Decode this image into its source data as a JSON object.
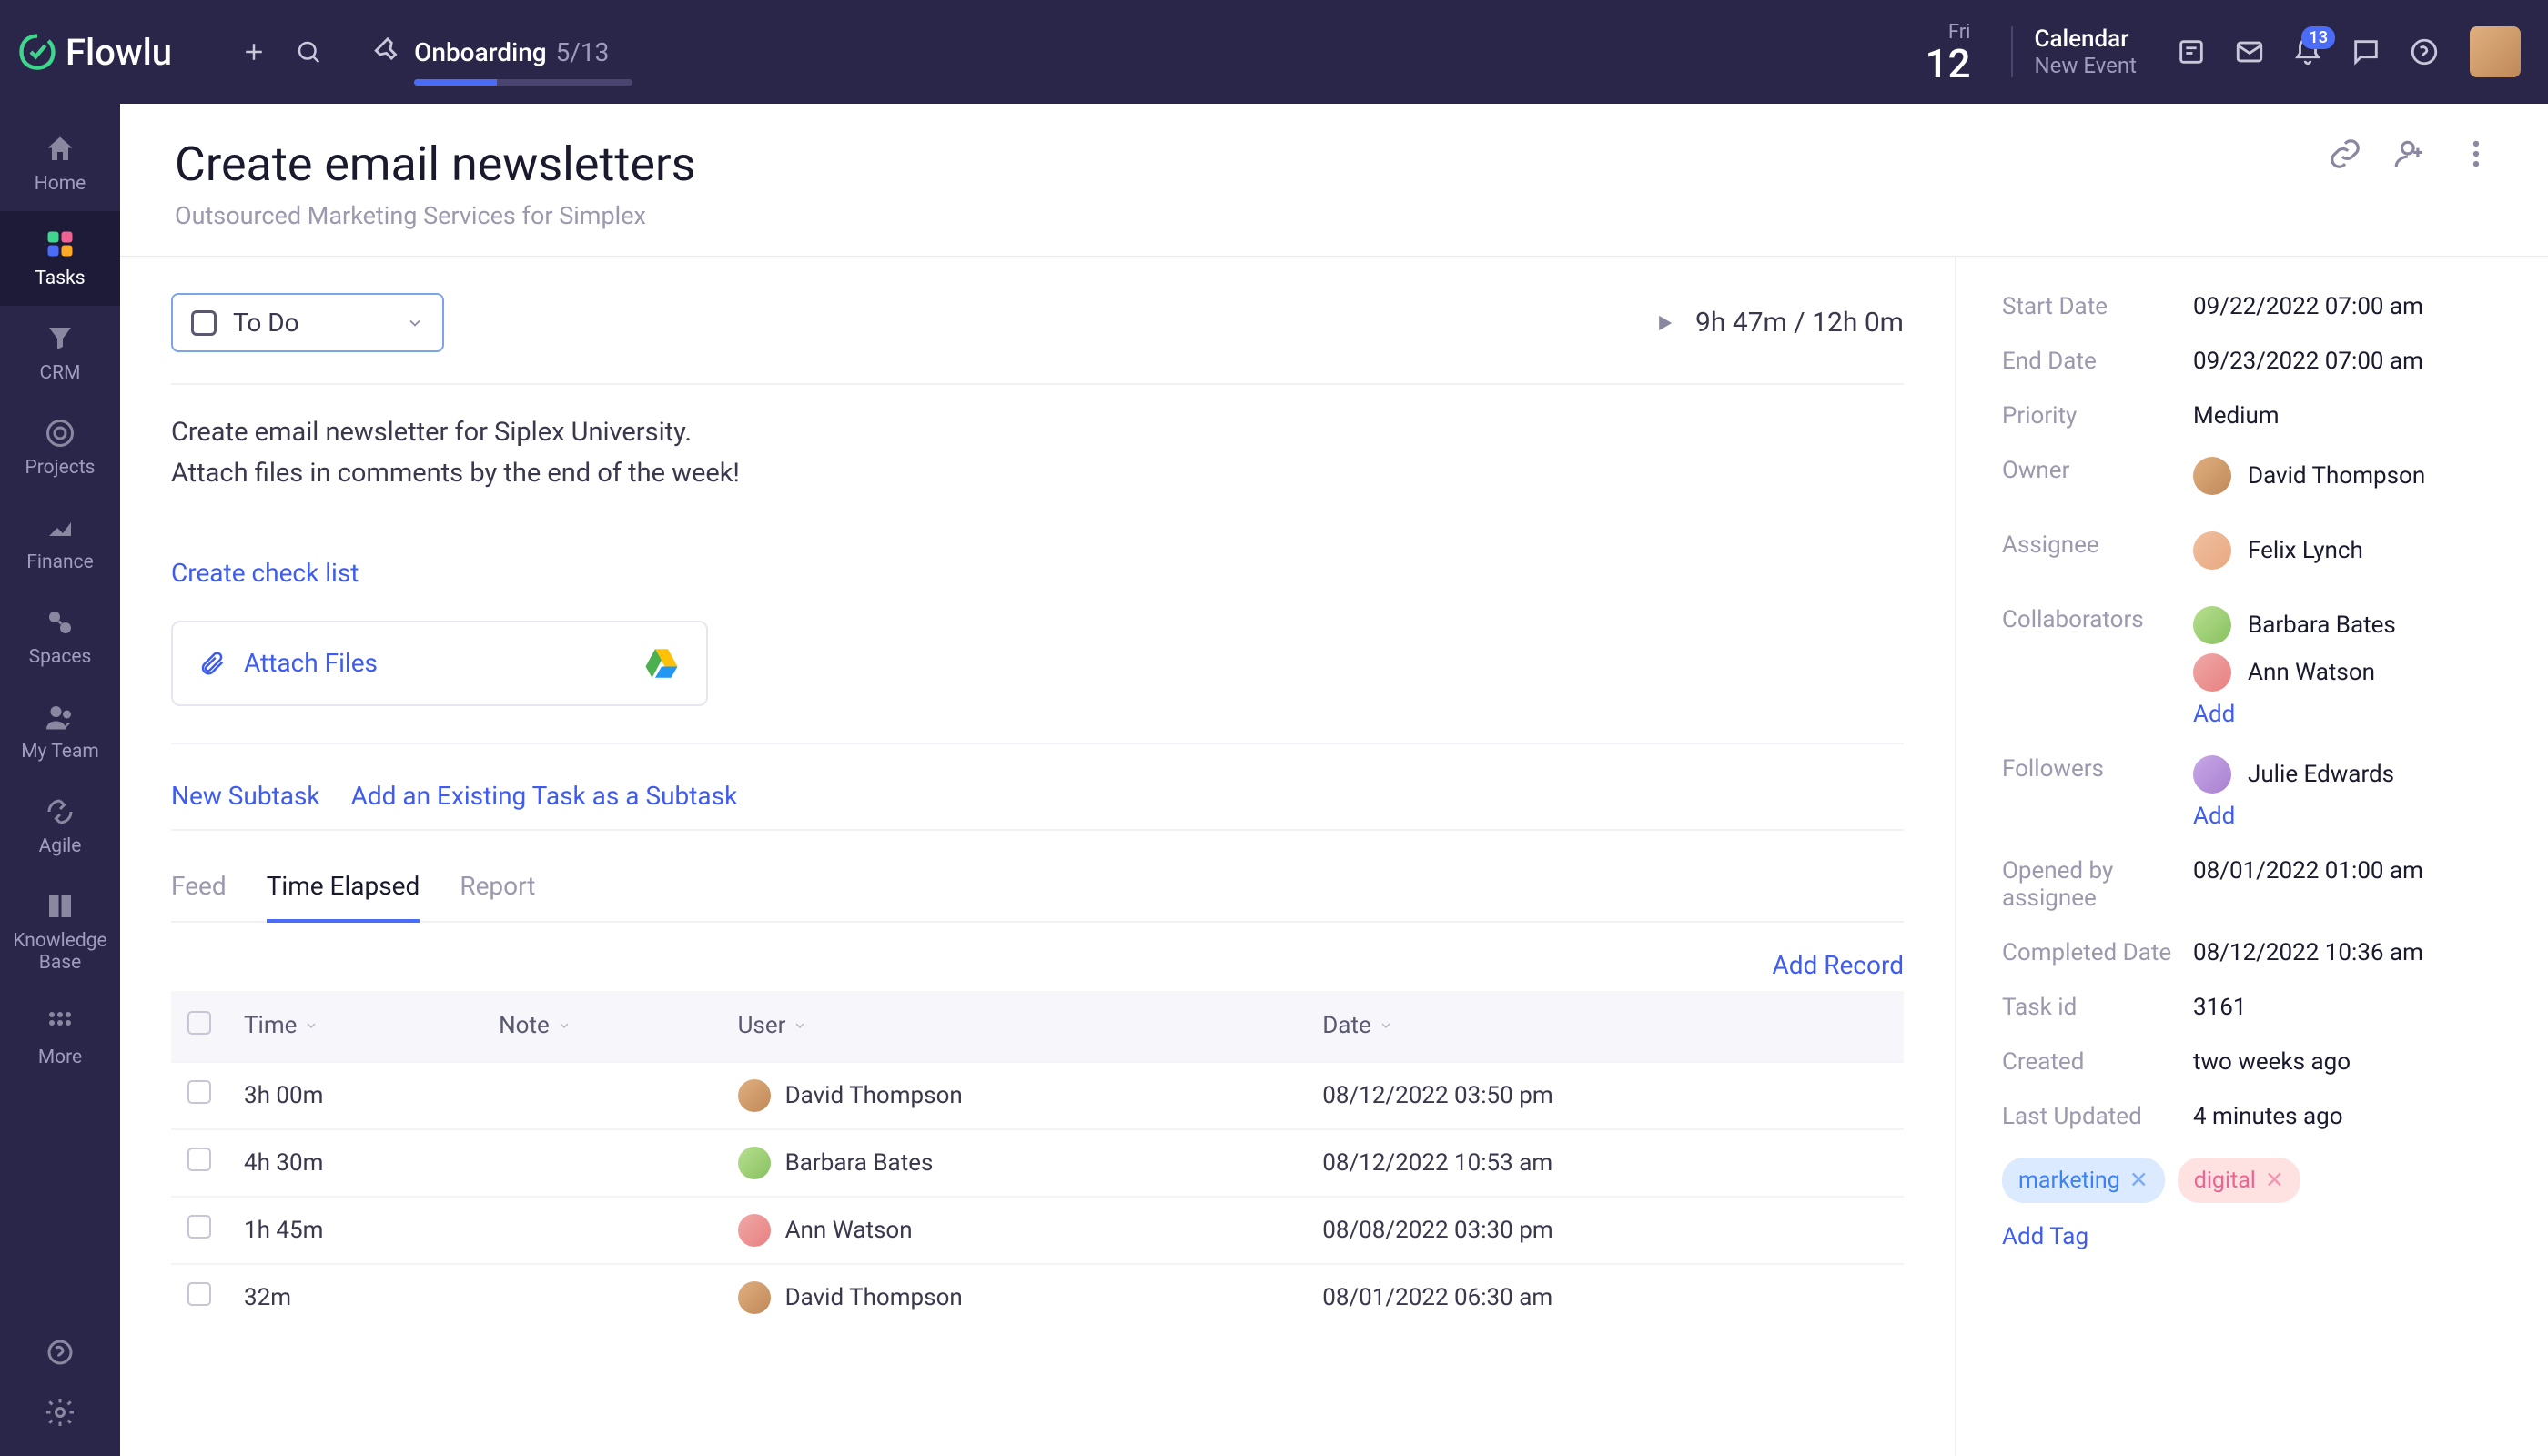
{
  "brand": "Flowlu",
  "onboarding": {
    "label": "Onboarding",
    "progress": "5/13"
  },
  "topbar_date": {
    "weekday": "Fri",
    "day": "12"
  },
  "calendar": {
    "title": "Calendar",
    "subtitle": "New Event"
  },
  "notification_count": "13",
  "nav": {
    "items": [
      {
        "label": "Home"
      },
      {
        "label": "Tasks"
      },
      {
        "label": "CRM"
      },
      {
        "label": "Projects"
      },
      {
        "label": "Finance"
      },
      {
        "label": "Spaces"
      },
      {
        "label": "My Team"
      },
      {
        "label": "Agile"
      },
      {
        "label": "Knowledge Base"
      },
      {
        "label": "More"
      }
    ]
  },
  "page": {
    "title": "Create email newsletters",
    "subtitle": "Outsourced Marketing Services for Simplex"
  },
  "status": {
    "label": "To Do"
  },
  "timer": "9h 47m / 12h 0m",
  "description_line1": "Create email newsletter for Siplex University.",
  "description_line2": "Attach files in comments by the end of the week!",
  "links": {
    "checklist": "Create check list",
    "attach": "Attach Files",
    "new_subtask": "New Subtask",
    "add_existing": "Add an Existing Task as a Subtask",
    "add_record": "Add Record",
    "add": "Add",
    "add_tag": "Add Tag"
  },
  "tabs": {
    "feed": "Feed",
    "time": "Time Elapsed",
    "report": "Report"
  },
  "table": {
    "headers": {
      "time": "Time",
      "note": "Note",
      "user": "User",
      "date": "Date"
    },
    "rows": [
      {
        "time": "3h 00m",
        "note": "",
        "user": "David Thompson",
        "date": "08/12/2022 03:50 pm",
        "avatar": "av1"
      },
      {
        "time": "4h 30m",
        "note": "",
        "user": "Barbara Bates",
        "date": "08/12/2022 10:53 am",
        "avatar": "av3"
      },
      {
        "time": "1h 45m",
        "note": "",
        "user": "Ann Watson",
        "date": "08/08/2022 03:30 pm",
        "avatar": "av4"
      },
      {
        "time": "32m",
        "note": "",
        "user": "David Thompson",
        "date": "08/01/2022 06:30 am",
        "avatar": "av1"
      }
    ]
  },
  "meta": {
    "start_date_label": "Start Date",
    "start_date": "09/22/2022 07:00 am",
    "end_date_label": "End Date",
    "end_date": "09/23/2022 07:00 am",
    "priority_label": "Priority",
    "priority": "Medium",
    "owner_label": "Owner",
    "owner": "David Thompson",
    "assignee_label": "Assignee",
    "assignee": "Felix Lynch",
    "collaborators_label": "Collaborators",
    "collaborators": [
      {
        "name": "Barbara Bates",
        "avatar": "av3"
      },
      {
        "name": "Ann Watson",
        "avatar": "av4"
      }
    ],
    "followers_label": "Followers",
    "followers": [
      {
        "name": "Julie Edwards",
        "avatar": "av5"
      }
    ],
    "opened_label": "Opened by assignee",
    "opened": "08/01/2022 01:00 am",
    "completed_label": "Completed Date",
    "completed": "08/12/2022 10:36 am",
    "taskid_label": "Task id",
    "taskid": "3161",
    "created_label": "Created",
    "created": "two weeks ago",
    "updated_label": "Last Updated",
    "updated": "4 minutes ago"
  },
  "tags": [
    {
      "label": "marketing",
      "style": "tag-blue"
    },
    {
      "label": "digital",
      "style": "tag-pink"
    }
  ]
}
